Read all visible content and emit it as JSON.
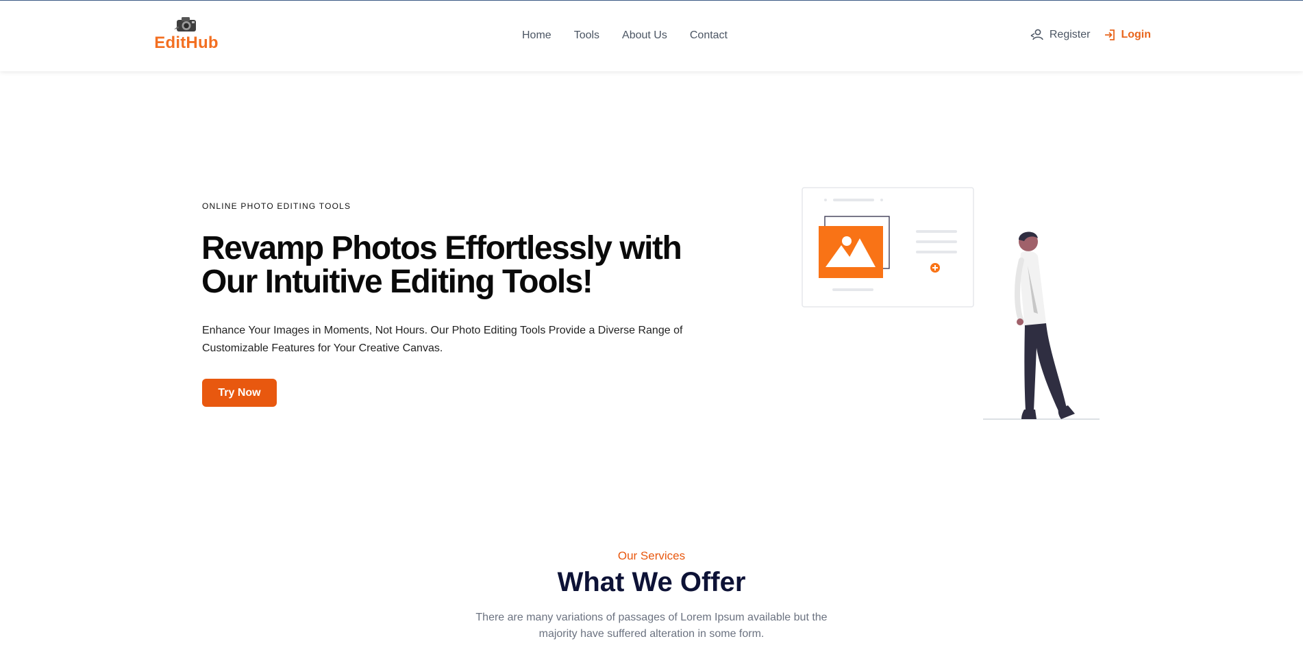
{
  "header": {
    "brand": "EditHub",
    "logo_icon": "camera-icon",
    "nav": [
      {
        "label": "Home"
      },
      {
        "label": "Tools"
      },
      {
        "label": "About Us"
      },
      {
        "label": "Contact"
      }
    ],
    "register_label": "Register",
    "register_icon": "user-arrow-icon",
    "login_label": "Login",
    "login_icon": "login-icon"
  },
  "hero": {
    "tag": "ONLINE PHOTO EDITING TOOLS",
    "title_line1": "Revamp Photos Effortlessly with",
    "title_line2": "Our Intuitive Editing Tools!",
    "description": "Enhance Your Images in Moments, Not Hours. Our Photo Editing Tools Provide a Diverse Range of Customizable Features for Your Creative Canvas.",
    "cta_label": "Try Now"
  },
  "services": {
    "kicker": "Our Services",
    "title": "What We Offer",
    "description": "There are many variations of passages of Lorem Ipsum available but the majority have suffered alteration in some form."
  },
  "colors": {
    "accent": "#f36f21",
    "button": "#e8580f",
    "heading_dark": "#0d1236",
    "figure_pants": "#2f2e41"
  }
}
